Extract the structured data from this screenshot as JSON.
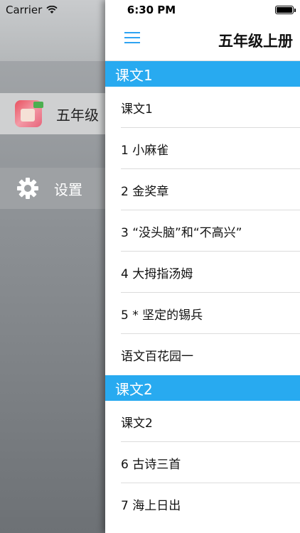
{
  "status": {
    "carrier": "Carrier",
    "time": "6:30 PM"
  },
  "drawer": {
    "items": [
      {
        "label": "五年级",
        "icon": "book-cover-icon"
      },
      {
        "label": "设置",
        "icon": "gear-icon"
      }
    ]
  },
  "nav": {
    "title": "五年级上册",
    "menu_icon": "hamburger-icon",
    "accent": "#2ea3f2"
  },
  "sections": [
    {
      "header": "课文1",
      "rows": [
        "课文1",
        "1 小麻雀",
        "2 金奖章",
        "3 “没头脑”和“不高兴”",
        "4 大拇指汤姆",
        "5 * 坚定的锡兵",
        "语文百花园一"
      ]
    },
    {
      "header": "课文2",
      "rows": [
        "课文2",
        "6 古诗三首",
        "7 海上日出"
      ]
    }
  ],
  "colors": {
    "section_header": "#28aaf0",
    "drawer_bg": "#8e9296"
  }
}
